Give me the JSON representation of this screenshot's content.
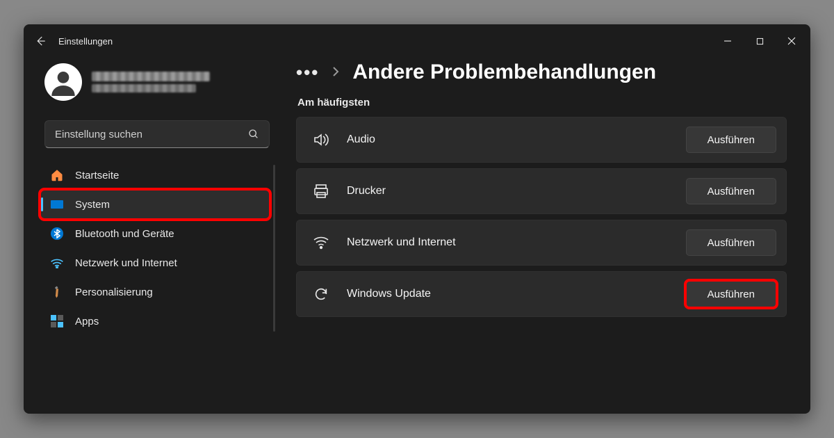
{
  "window": {
    "app_title": "Einstellungen"
  },
  "search": {
    "placeholder": "Einstellung suchen"
  },
  "sidebar": {
    "items": [
      {
        "label": "Startseite"
      },
      {
        "label": "System"
      },
      {
        "label": "Bluetooth und Geräte"
      },
      {
        "label": "Netzwerk und Internet"
      },
      {
        "label": "Personalisierung"
      },
      {
        "label": "Apps"
      }
    ]
  },
  "breadcrumb": {
    "more": "•••",
    "title": "Andere Problembehandlungen"
  },
  "main": {
    "section_label": "Am häufigsten",
    "run_label": "Ausführen",
    "troubleshooters": [
      {
        "label": "Audio"
      },
      {
        "label": "Drucker"
      },
      {
        "label": "Netzwerk und Internet"
      },
      {
        "label": "Windows Update"
      }
    ]
  }
}
